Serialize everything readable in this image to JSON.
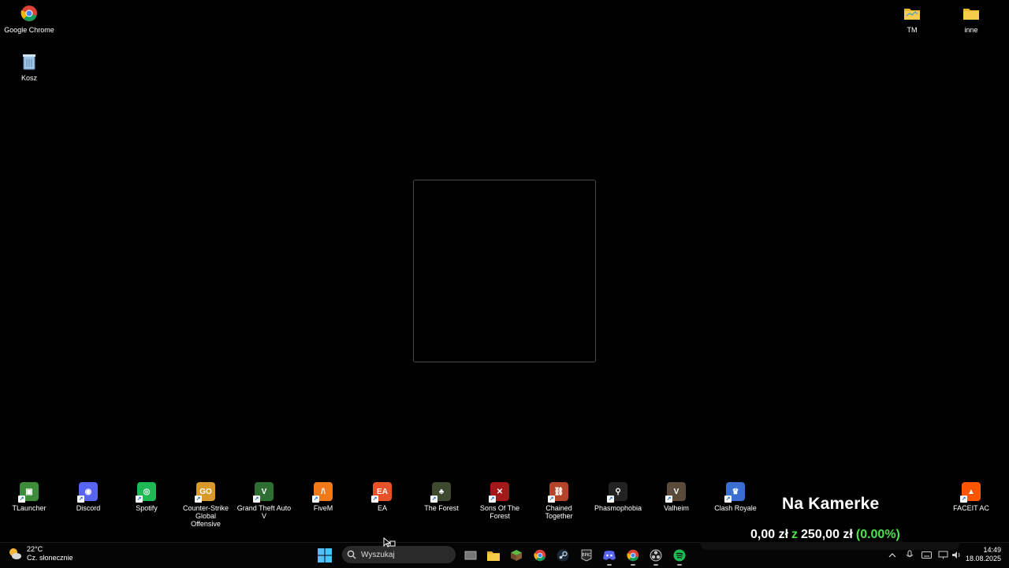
{
  "desktop_top_icons": [
    {
      "name": "google-chrome",
      "label": "Google Chrome"
    },
    {
      "name": "recycle-bin",
      "label": "Kosz"
    },
    {
      "name": "folder-tm",
      "label": "TM"
    },
    {
      "name": "folder-inne",
      "label": "inne"
    }
  ],
  "desktop_bottom_icons": [
    {
      "name": "tlauncher",
      "label": "TLauncher",
      "icon": "minecraft-grass-block-icon",
      "color": "#3d8c3a"
    },
    {
      "name": "discord",
      "label": "Discord",
      "icon": "discord-icon",
      "color": "#5865f2"
    },
    {
      "name": "spotify",
      "label": "Spotify",
      "icon": "spotify-icon",
      "color": "#1db954"
    },
    {
      "name": "csgo",
      "label": "Counter-Strike Global Offensive",
      "icon": "csgo-icon",
      "color": "#d99a2b"
    },
    {
      "name": "gta-v",
      "label": "Grand Theft Auto V",
      "icon": "gta-v-icon",
      "color": "#2f6e33"
    },
    {
      "name": "fivem",
      "label": "FiveM",
      "icon": "fivem-icon",
      "color": "#f07a1a"
    },
    {
      "name": "ea",
      "label": "EA",
      "icon": "ea-icon",
      "color": "#e8522a"
    },
    {
      "name": "the-forest",
      "label": "The Forest",
      "icon": "the-forest-icon",
      "color": "#3e4a2e"
    },
    {
      "name": "sons-of-the-forest",
      "label": "Sons Of The Forest",
      "icon": "sons-of-the-forest-icon",
      "color": "#a31919"
    },
    {
      "name": "chained-together",
      "label": "Chained Together",
      "icon": "chained-together-icon",
      "color": "#b5452a"
    },
    {
      "name": "phasmophobia",
      "label": "Phasmophobia",
      "icon": "phasmophobia-icon",
      "color": "#222"
    },
    {
      "name": "valheim",
      "label": "Valheim",
      "icon": "valheim-icon",
      "color": "#5a4a3a"
    },
    {
      "name": "clash-royale",
      "label": "Clash Royale",
      "icon": "clash-royale-icon",
      "color": "#3a6ed0"
    },
    {
      "name": "faceit-ac",
      "label": "FACEIT AC",
      "icon": "faceit-icon",
      "color": "#ff5500"
    }
  ],
  "overlay": {
    "title": "Na Kamerke",
    "current": "0,00 zł",
    "separator": "z",
    "goal": "250,00 zł",
    "percent": "(0.00%)"
  },
  "taskbar": {
    "weather_temp": "22°C",
    "weather_desc": "Cz. słonecznie",
    "search_placeholder": "Wyszukaj",
    "time": "14:49",
    "date": "18.08.2025"
  },
  "colors": {
    "accent_green": "#4de34d",
    "background": "#000000"
  }
}
